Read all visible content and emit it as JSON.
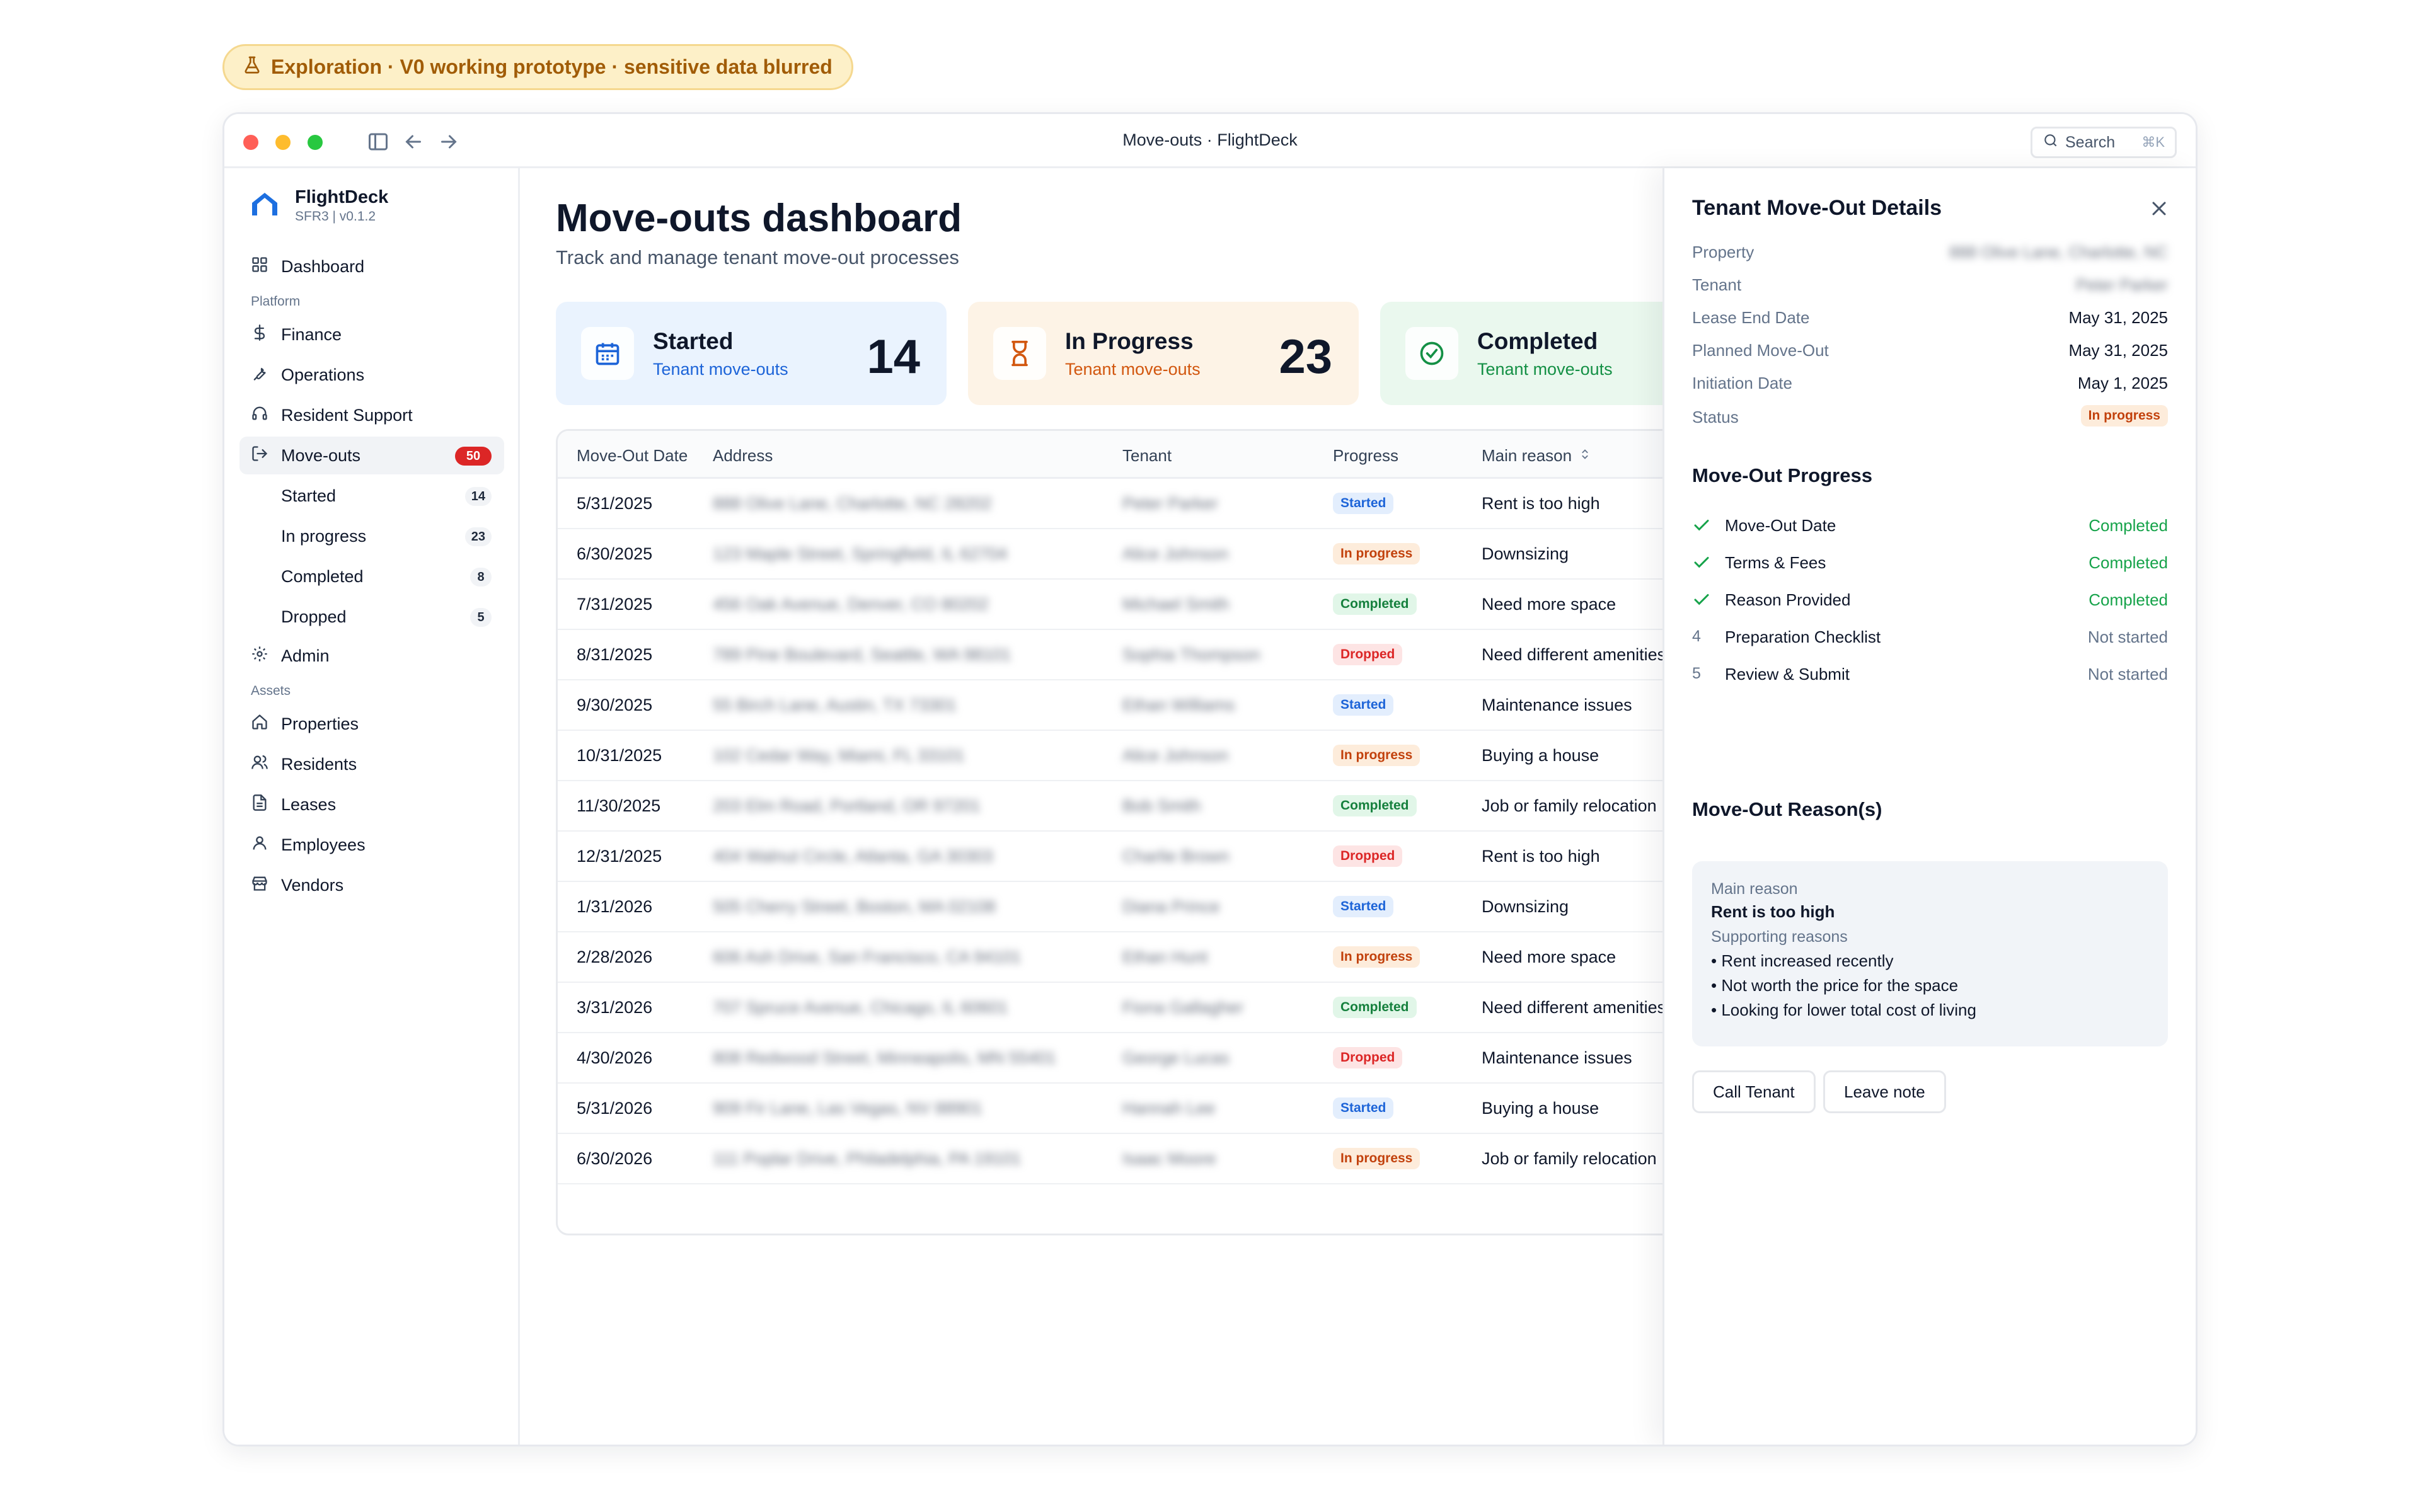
{
  "banner": {
    "text": "Exploration · V0 working prototype · sensitive data blurred",
    "icon": "flask-icon"
  },
  "window": {
    "title": "Move-outs · FlightDeck",
    "search_label": "Search",
    "search_shortcut": "⌘K"
  },
  "sidebar": {
    "brand_name": "FlightDeck",
    "brand_version": "SFR3 | v0.1.2",
    "dashboard": "Dashboard",
    "section_platform": "Platform",
    "finance": "Finance",
    "operations": "Operations",
    "resident_support": "Resident Support",
    "moveouts": {
      "label": "Move-outs",
      "count": "50"
    },
    "sub": [
      {
        "label": "Started",
        "count": "14"
      },
      {
        "label": "In progress",
        "count": "23"
      },
      {
        "label": "Completed",
        "count": "8"
      },
      {
        "label": "Dropped",
        "count": "5"
      }
    ],
    "admin": "Admin",
    "section_assets": "Assets",
    "properties": "Properties",
    "residents": "Residents",
    "leases": "Leases",
    "employees": "Employees",
    "vendors": "Vendors"
  },
  "main": {
    "title": "Move-outs dashboard",
    "subtitle": "Track and manage tenant move-out processes",
    "cards": [
      {
        "title": "Started",
        "sub": "Tenant move-outs",
        "count": "14",
        "color": "#1d64d8"
      },
      {
        "title": "In Progress",
        "sub": "Tenant move-outs",
        "count": "23",
        "color": "#d2570f"
      },
      {
        "title": "Completed",
        "sub": "Tenant move-outs",
        "count": "",
        "color": "#149045"
      }
    ],
    "table": {
      "headers": [
        "Move-Out Date",
        "Address",
        "Tenant",
        "Progress",
        "Main reason"
      ],
      "rows": [
        {
          "date": "5/31/2025",
          "address": "888 Olive Lane, Charlotte, NC 28202",
          "tenant": "Peter Parker",
          "progress": "Started",
          "reason": "Rent is too high"
        },
        {
          "date": "6/30/2025",
          "address": "123 Maple Street, Springfield, IL 62704",
          "tenant": "Alice Johnson",
          "progress": "In progress",
          "reason": "Downsizing"
        },
        {
          "date": "7/31/2025",
          "address": "456 Oak Avenue, Denver, CO 80202",
          "tenant": "Michael Smith",
          "progress": "Completed",
          "reason": "Need more space"
        },
        {
          "date": "8/31/2025",
          "address": "789 Pine Boulevard, Seattle, WA 98101",
          "tenant": "Sophia Thompson",
          "progress": "Dropped",
          "reason": "Need different amenities"
        },
        {
          "date": "9/30/2025",
          "address": "55 Birch Lane, Austin, TX 73301",
          "tenant": "Ethan Williams",
          "progress": "Started",
          "reason": "Maintenance issues"
        },
        {
          "date": "10/31/2025",
          "address": "102 Cedar Way, Miami, FL 33101",
          "tenant": "Alice Johnson",
          "progress": "In progress",
          "reason": "Buying a house"
        },
        {
          "date": "11/30/2025",
          "address": "203 Elm Road, Portland, OR 97201",
          "tenant": "Bob Smith",
          "progress": "Completed",
          "reason": "Job or family relocation"
        },
        {
          "date": "12/31/2025",
          "address": "404 Walnut Circle, Atlanta, GA 30303",
          "tenant": "Charlie Brown",
          "progress": "Dropped",
          "reason": "Rent is too high"
        },
        {
          "date": "1/31/2026",
          "address": "505 Cherry Street, Boston, MA 02108",
          "tenant": "Diana Prince",
          "progress": "Started",
          "reason": "Downsizing"
        },
        {
          "date": "2/28/2026",
          "address": "606 Ash Drive, San Francisco, CA 94101",
          "tenant": "Ethan Hunt",
          "progress": "In progress",
          "reason": "Need more space"
        },
        {
          "date": "3/31/2026",
          "address": "707 Spruce Avenue, Chicago, IL 60601",
          "tenant": "Fiona Gallagher",
          "progress": "Completed",
          "reason": "Need different amenities"
        },
        {
          "date": "4/30/2026",
          "address": "808 Redwood Street, Minneapolis, MN 55401",
          "tenant": "George Lucas",
          "progress": "Dropped",
          "reason": "Maintenance issues"
        },
        {
          "date": "5/31/2026",
          "address": "909 Fir Lane, Las Vegas, NV 88901",
          "tenant": "Hannah Lee",
          "progress": "Started",
          "reason": "Buying a house"
        },
        {
          "date": "6/30/2026",
          "address": "111 Poplar Drive, Philadelphia, PA 19101",
          "tenant": "Isaac Moore",
          "progress": "In progress",
          "reason": "Job or family relocation"
        }
      ]
    }
  },
  "panel": {
    "title": "Tenant Move-Out Details",
    "fields": [
      {
        "k": "Property",
        "v": "888 Olive Lane, Charlotte, NC"
      },
      {
        "k": "Tenant",
        "v": "Peter Parker"
      },
      {
        "k": "Lease End Date",
        "v": "May 31, 2025"
      },
      {
        "k": "Planned Move-Out",
        "v": "May 31, 2025"
      },
      {
        "k": "Initiation Date",
        "v": "May 1, 2025"
      },
      {
        "k": "Status",
        "v": "In progress"
      }
    ],
    "progress_title": "Move-Out Progress",
    "steps": [
      {
        "marker": "",
        "label": "Move-Out Date",
        "status": "Completed"
      },
      {
        "marker": "",
        "label": "Terms & Fees",
        "status": "Completed"
      },
      {
        "marker": "",
        "label": "Reason Provided",
        "status": "Completed"
      },
      {
        "marker": "4",
        "label": "Preparation Checklist",
        "status": "Not started"
      },
      {
        "marker": "5",
        "label": "Review & Submit",
        "status": "Not started"
      }
    ],
    "reasons_title": "Move-Out Reason(s)",
    "main_reason_label": "Main reason",
    "main_reason": "Rent is too high",
    "supporting_label": "Supporting reasons",
    "supporting": [
      "• Rent increased recently",
      "• Not worth the price for the space",
      "• Looking for lower total cost of living"
    ],
    "call_button": "Call Tenant",
    "note_button": "Leave note"
  }
}
